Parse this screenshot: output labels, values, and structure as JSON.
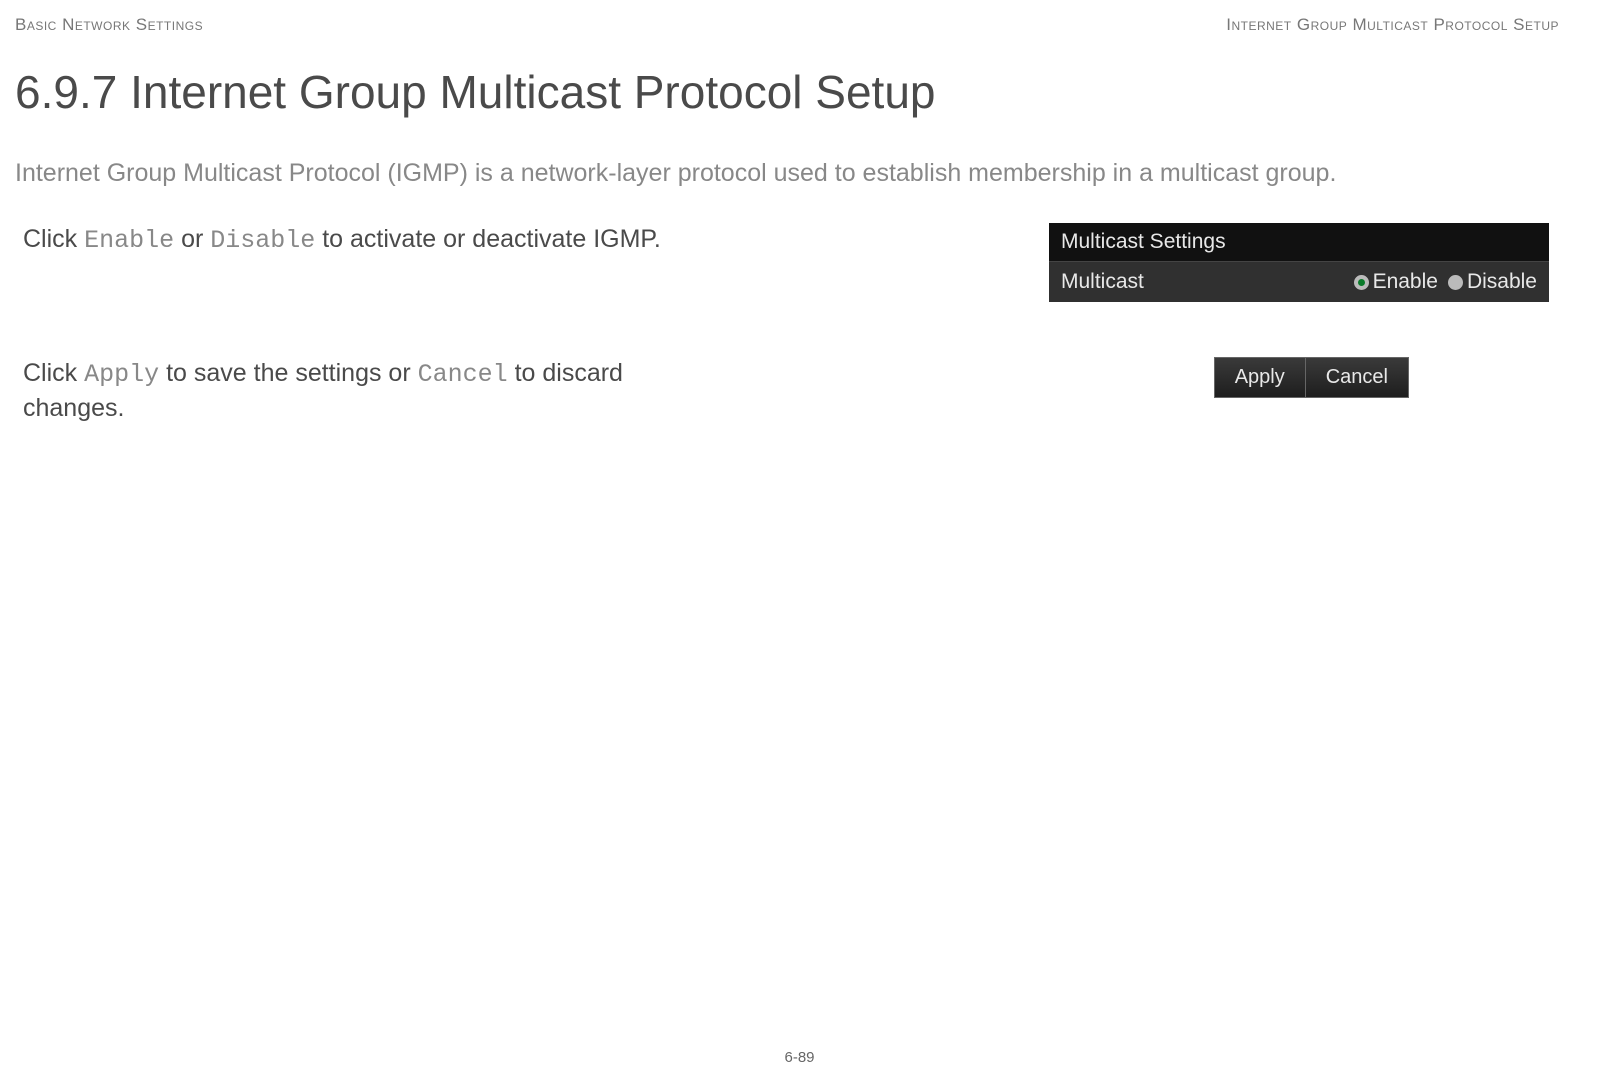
{
  "header": {
    "left": "Basic Network Settings",
    "right": "Internet Group Multicast Protocol Setup"
  },
  "title": "6.9.7 Internet Group Multicast Protocol Setup",
  "intro": "Internet Group Multicast Protocol (IGMP) is a network-layer protocol used to establish membership in a multicast group.",
  "instructions": {
    "line1_pre": "Click ",
    "line1_enable": "Enable",
    "line1_mid": " or ",
    "line1_disable": "Disable",
    "line1_post": " to activate or deactivate IGMP.",
    "line2_pre": "Click ",
    "line2_apply": "Apply",
    "line2_mid": " to save the settings or ",
    "line2_cancel": "Cancel",
    "line2_post": " to discard changes."
  },
  "panel": {
    "title": "Multicast Settings",
    "row_label": "Multicast",
    "options": {
      "enable": "Enable",
      "disable": "Disable",
      "selected": "enable"
    }
  },
  "buttons": {
    "apply": "Apply",
    "cancel": "Cancel"
  },
  "page_number": "6-89"
}
